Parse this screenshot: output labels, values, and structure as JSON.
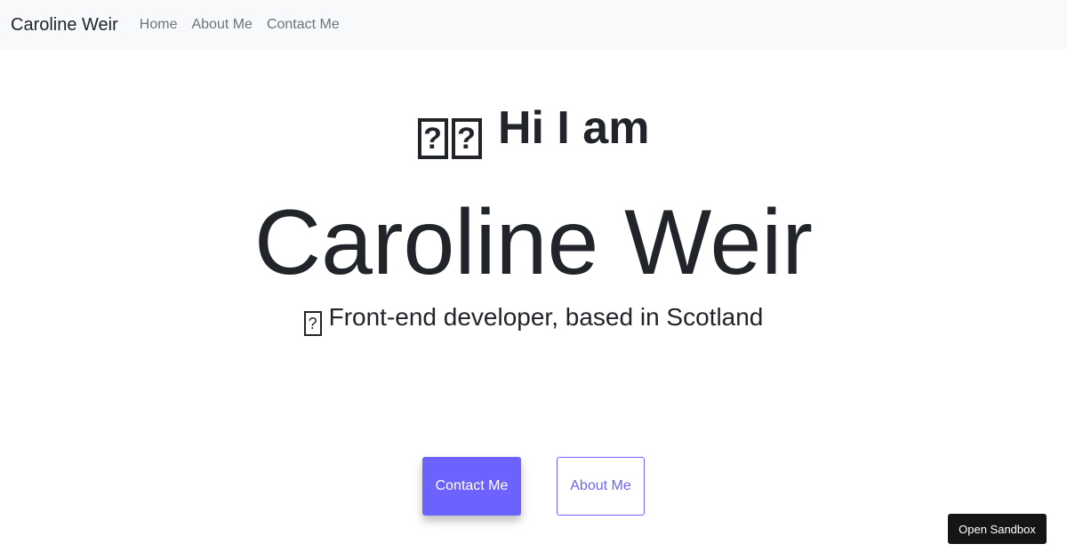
{
  "navbar": {
    "brand": "Caroline Weir",
    "links": [
      "Home",
      "About Me",
      "Contact Me"
    ]
  },
  "hero": {
    "greeting_glyphs": [
      "?",
      "?"
    ],
    "greeting": "Hi I am",
    "name": "Caroline Weir",
    "subtitle_glyph": "?",
    "subtitle": "Front-end developer, based in Scotland"
  },
  "buttons": {
    "contact": "Contact Me",
    "about": "About Me"
  },
  "sandbox": {
    "label": "Open Sandbox"
  },
  "colors": {
    "accent": "#6c63ff",
    "navbar_bg": "#f8f9fa",
    "text": "#212529",
    "nav_link": "#6c757d",
    "sandbox_bg": "#151515"
  }
}
